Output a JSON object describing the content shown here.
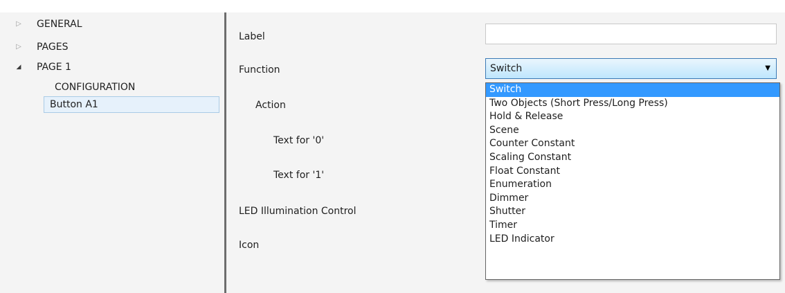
{
  "tree": {
    "items": [
      {
        "label": "GENERAL",
        "arrow": "▷"
      },
      {
        "label": "PAGES",
        "arrow": "▷"
      },
      {
        "label": "PAGE 1",
        "arrow": "◢"
      },
      {
        "label": "CONFIGURATION",
        "arrow": ""
      },
      {
        "label": "Button A1",
        "arrow": ""
      }
    ]
  },
  "params": {
    "label": "Label",
    "function": "Function",
    "action": "Action",
    "text0": "Text for '0'",
    "text1": "Text for '1'",
    "led": "LED Illumination Control",
    "icon": "Icon"
  },
  "label_input": {
    "value": ""
  },
  "function_select": {
    "value": "Switch",
    "caret": "▼"
  },
  "dropdown": {
    "options": [
      "Switch",
      "Two Objects (Short Press/Long Press)",
      "Hold & Release",
      "Scene",
      "Counter Constant",
      "Scaling Constant",
      "Float Constant",
      "Enumeration",
      "Dimmer",
      "Shutter",
      "Timer",
      "LED Indicator"
    ]
  },
  "colors": {
    "selection_highlight": "#3399ff",
    "tree_selected_bg": "#e6f1fb",
    "splitter": "#6d6d6d"
  }
}
